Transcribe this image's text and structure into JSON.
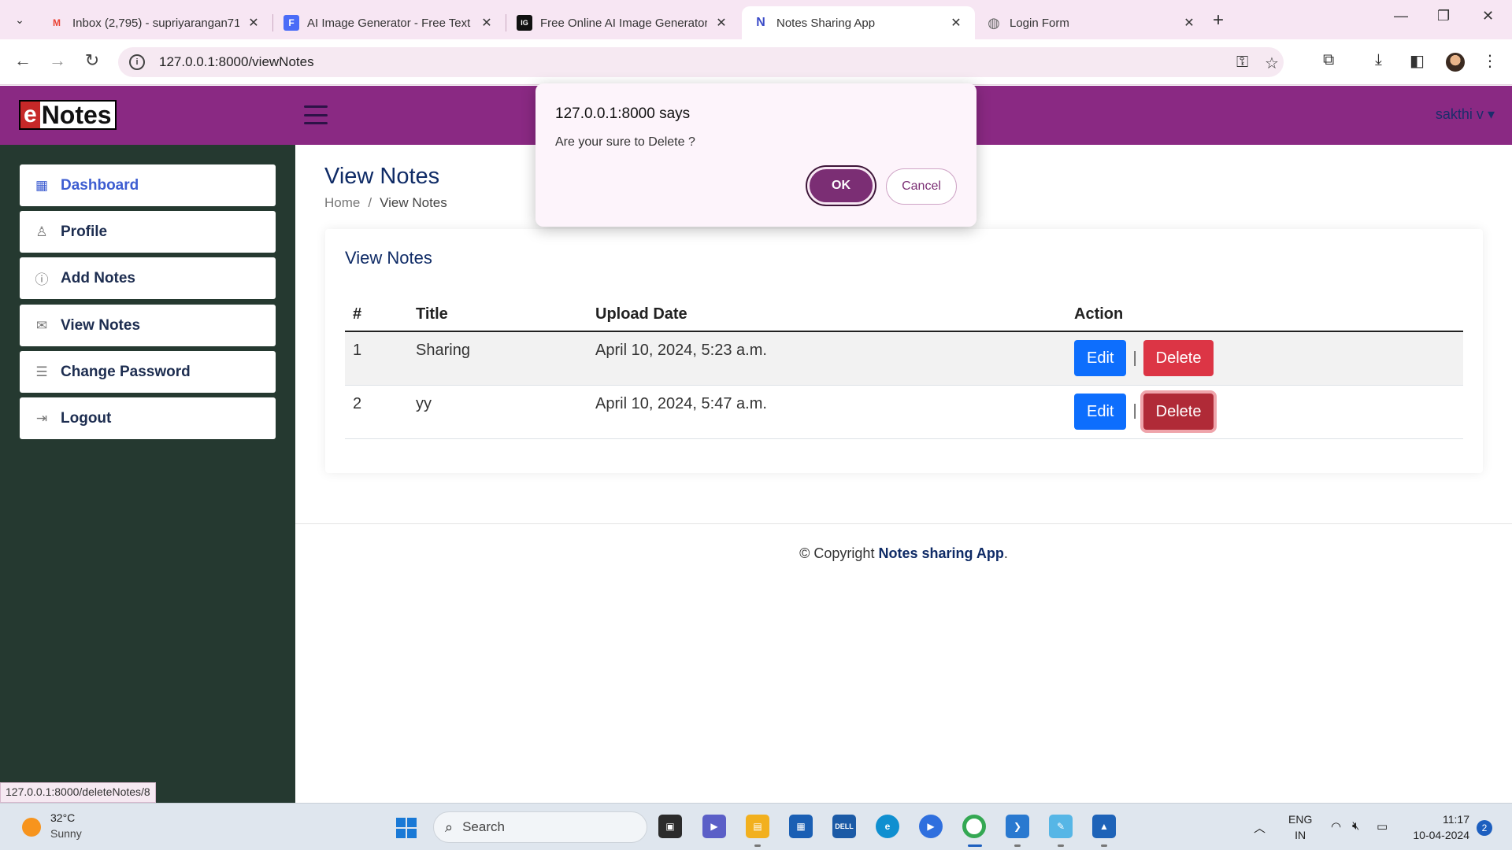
{
  "browser": {
    "tabs": [
      {
        "title": "Inbox (2,795) - supriyarangan71",
        "favicon": "M",
        "favicon_color": "#ea4335"
      },
      {
        "title": "AI Image Generator - Free Text",
        "favicon": "F",
        "favicon_color": "#4a6cf7"
      },
      {
        "title": "Free Online AI Image Generator",
        "favicon": "IG",
        "favicon_color": "#111111"
      },
      {
        "title": "Notes Sharing App",
        "favicon": "N",
        "favicon_color": "#3c4cc8"
      },
      {
        "title": "Login Form",
        "favicon": "◍",
        "favicon_color": "#666666"
      }
    ],
    "url": "127.0.0.1:8000/viewNotes",
    "status_url": "127.0.0.1:8000/deleteNotes/8"
  },
  "app": {
    "logo_e": "e",
    "logo_text": "Notes",
    "user": "sakthi v"
  },
  "sidebar": {
    "items": [
      {
        "label": "Dashboard",
        "icon": "grid-icon"
      },
      {
        "label": "Profile",
        "icon": "person-icon"
      },
      {
        "label": "Add Notes",
        "icon": "question-circle-icon"
      },
      {
        "label": "View Notes",
        "icon": "envelope-icon"
      },
      {
        "label": "Change Password",
        "icon": "card-list-icon"
      },
      {
        "label": "Logout",
        "icon": "box-arrow-in-icon"
      }
    ]
  },
  "main": {
    "page_title": "View Notes",
    "breadcrumb": [
      "Home",
      "View Notes"
    ],
    "card_title": "View Notes",
    "table": {
      "headers": [
        "#",
        "Title",
        "Upload Date",
        "Action"
      ],
      "rows": [
        {
          "num": "1",
          "title": "Sharing",
          "date": "April 10, 2024, 5:23 a.m.",
          "edit": "Edit",
          "delete": "Delete"
        },
        {
          "num": "2",
          "title": "yy",
          "date": "April 10, 2024, 5:47 a.m.",
          "edit": "Edit",
          "delete": "Delete"
        }
      ]
    },
    "footer_prefix": "© Copyright",
    "footer_brand": "Notes sharing App",
    "footer_suffix": "."
  },
  "dialog": {
    "title": "127.0.0.1:8000 says",
    "message": "Are your sure to Delete ?",
    "ok": "OK",
    "cancel": "Cancel"
  },
  "taskbar": {
    "temp": "32°C",
    "weather": "Sunny",
    "search": "Search",
    "lang_1": "ENG",
    "lang_2": "IN",
    "time": "11:17",
    "date": "10-04-2024",
    "notifications": "2"
  },
  "colors": {
    "header": "#8a2983",
    "sidebar": "#253930",
    "edit": "#0d6efd",
    "delete": "#dc3545"
  }
}
